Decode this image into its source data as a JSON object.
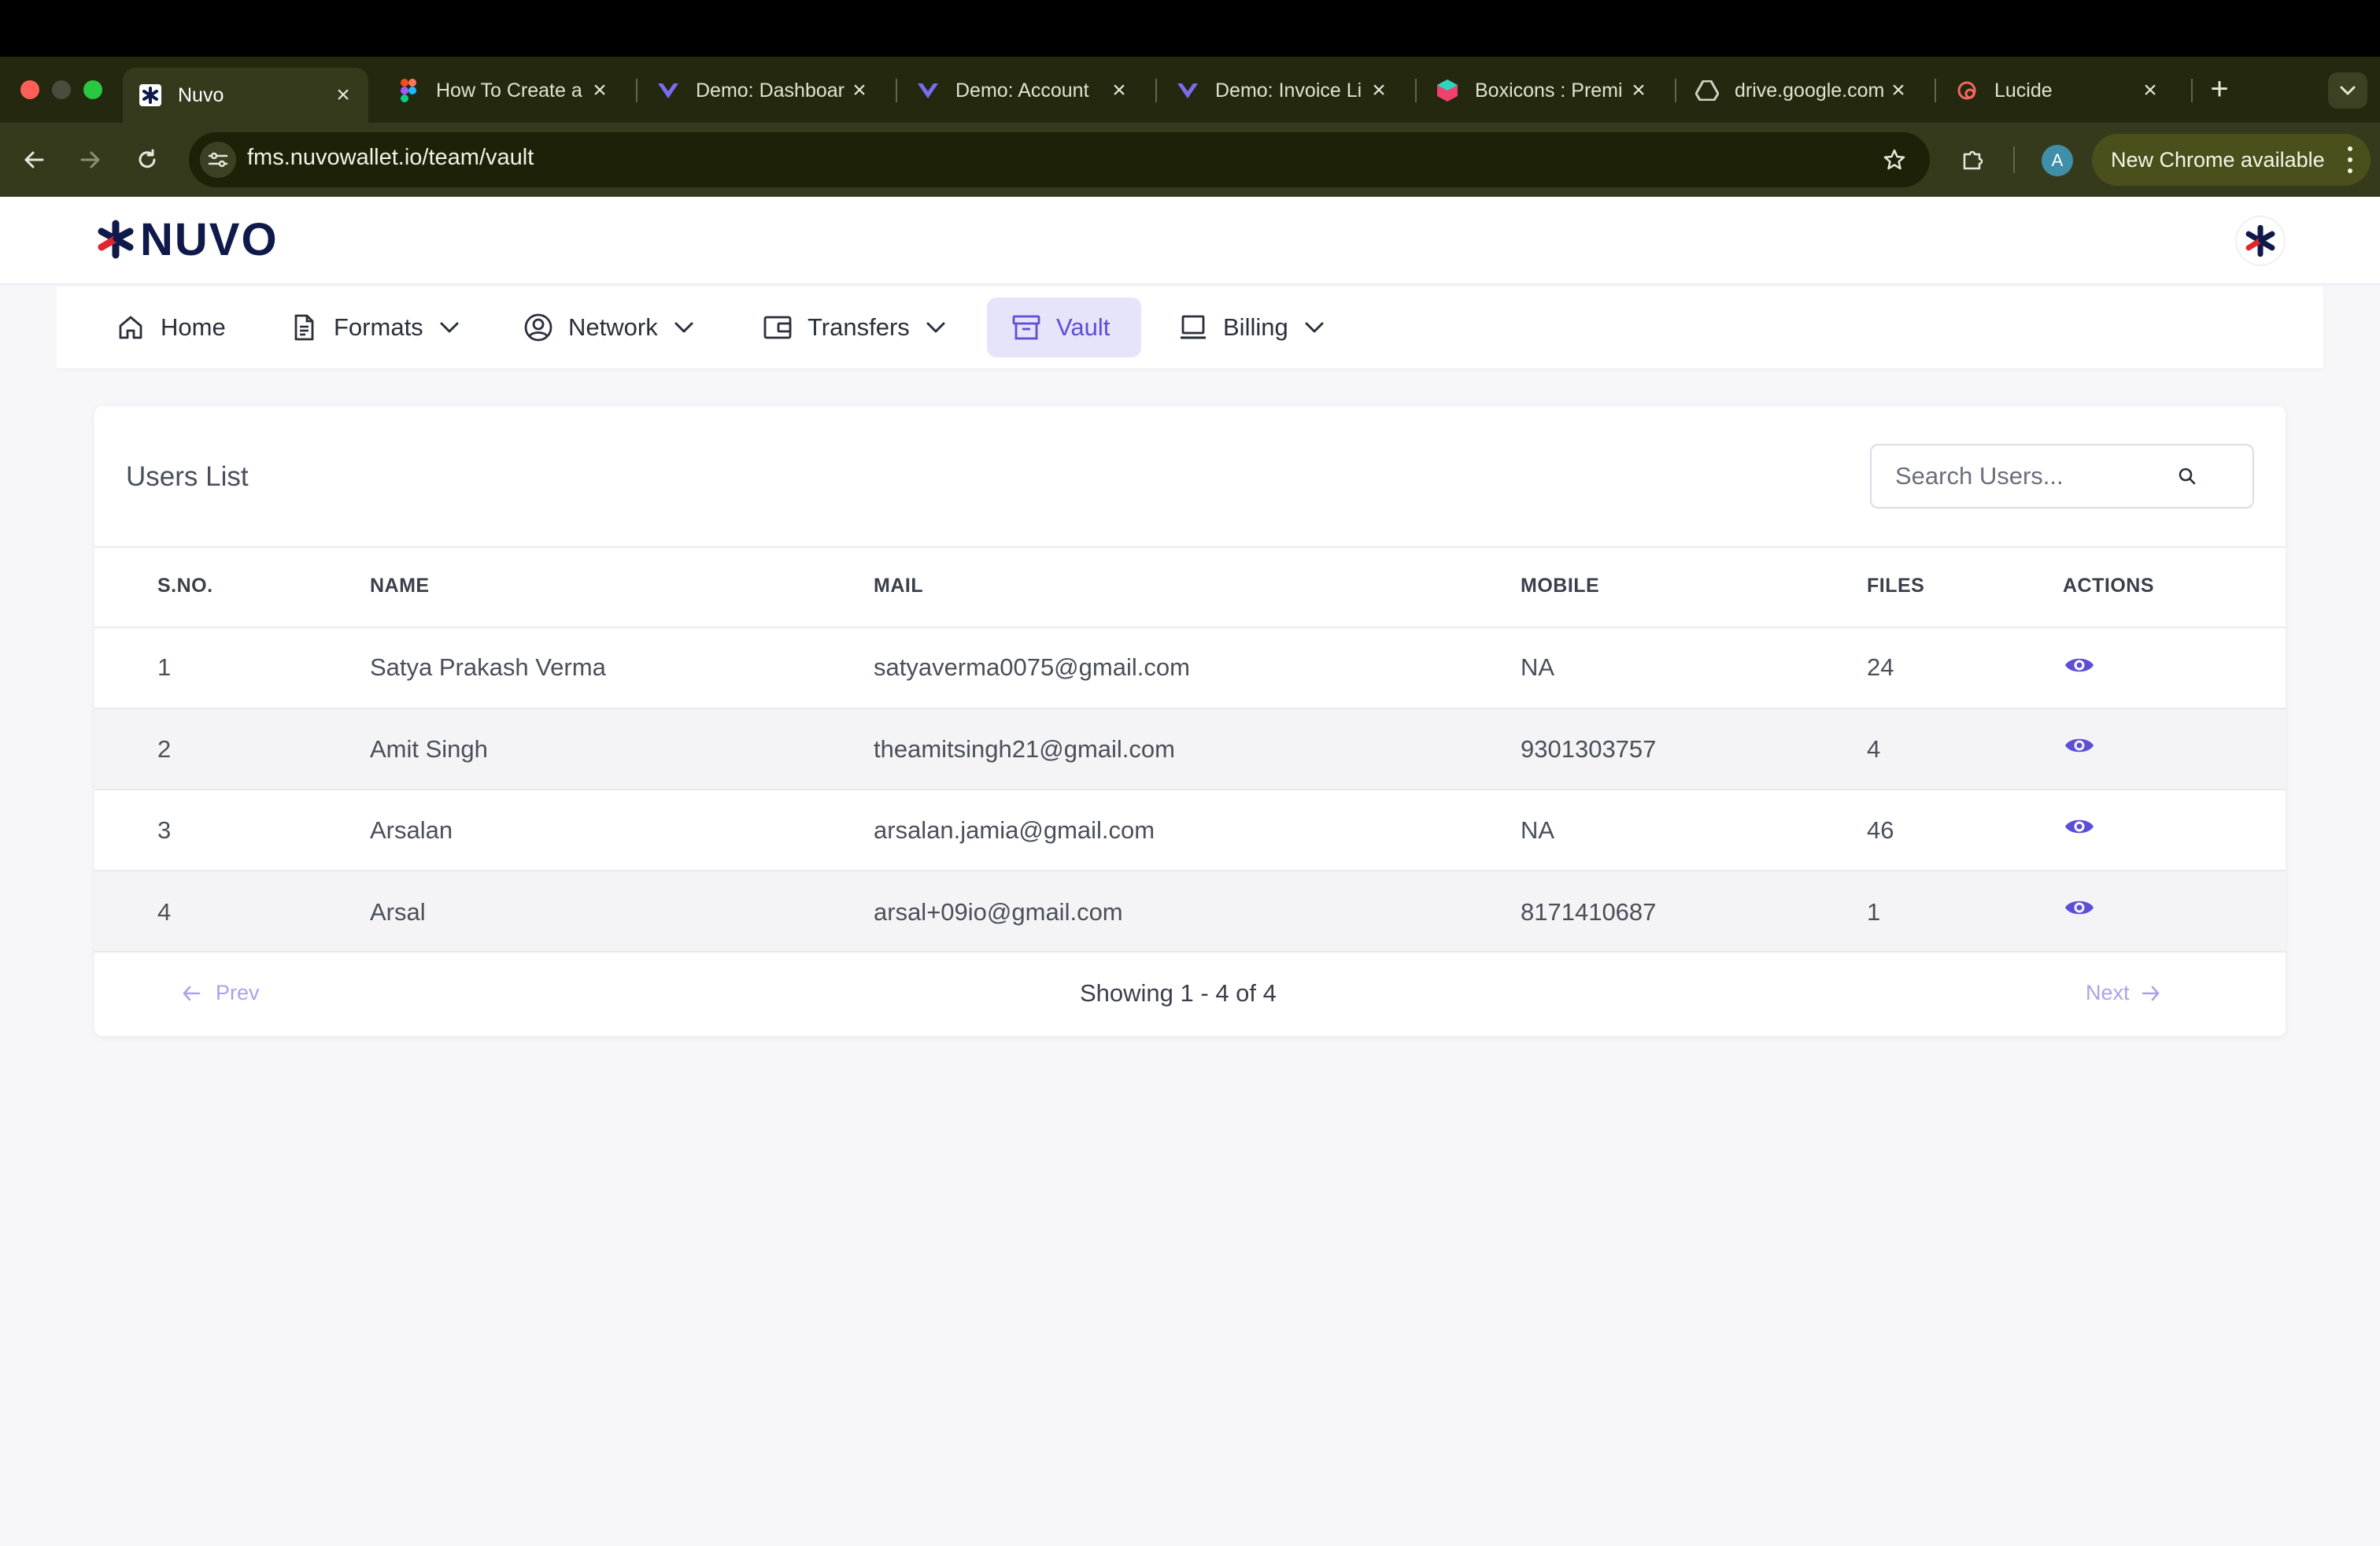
{
  "browser": {
    "tabs": [
      {
        "title": "Nuvo",
        "favicon": "nuvo-asterisk-icon",
        "active": true
      },
      {
        "title": "How To Create a",
        "favicon": "figma-icon"
      },
      {
        "title": "Demo: Dashboar",
        "favicon": "heart-logo-icon"
      },
      {
        "title": "Demo: Account",
        "favicon": "heart-logo-icon"
      },
      {
        "title": "Demo: Invoice Li",
        "favicon": "heart-logo-icon"
      },
      {
        "title": "Boxicons : Premi",
        "favicon": "boxicons-icon"
      },
      {
        "title": "drive.google.com",
        "favicon": "drive-icon"
      },
      {
        "title": "Lucide",
        "favicon": "lucide-icon"
      }
    ],
    "url": "fms.nuvowallet.io/team/vault",
    "profile_initial": "A",
    "update_label": "New Chrome available"
  },
  "app": {
    "logo_text": "NUVO",
    "nav": [
      {
        "label": "Home",
        "icon": "home-icon",
        "dropdown": false
      },
      {
        "label": "Formats",
        "icon": "file-text-icon",
        "dropdown": true
      },
      {
        "label": "Network",
        "icon": "user-circle-icon",
        "dropdown": true
      },
      {
        "label": "Transfers",
        "icon": "wallet-icon",
        "dropdown": true
      },
      {
        "label": "Vault",
        "icon": "archive-icon",
        "dropdown": false,
        "active": true
      },
      {
        "label": "Billing",
        "icon": "laptop-icon",
        "dropdown": true
      }
    ]
  },
  "users_card": {
    "title": "Users List",
    "search_placeholder": "Search Users...",
    "columns": [
      "S.NO.",
      "NAME",
      "MAIL",
      "MOBILE",
      "FILES",
      "ACTIONS"
    ],
    "rows": [
      {
        "sno": "1",
        "name": "Satya Prakash Verma",
        "mail": "satyaverma0075@gmail.com",
        "mobile": "NA",
        "files": "24"
      },
      {
        "sno": "2",
        "name": "Amit Singh",
        "mail": "theamitsingh21@gmail.com",
        "mobile": "9301303757",
        "files": "4"
      },
      {
        "sno": "3",
        "name": "Arsalan",
        "mail": "arsalan.jamia@gmail.com",
        "mobile": "NA",
        "files": "46"
      },
      {
        "sno": "4",
        "name": "Arsal",
        "mail": "arsal+09io@gmail.com",
        "mobile": "8171410687",
        "files": "1"
      }
    ],
    "pagination": {
      "prev": "Prev",
      "next": "Next",
      "status": "Showing 1 - 4 of 4"
    }
  },
  "colors": {
    "accent": "#5b4fd6",
    "accent_bg": "#e6e4fb",
    "brand_navy": "#0f1a4a",
    "brand_red": "#e2262d"
  }
}
